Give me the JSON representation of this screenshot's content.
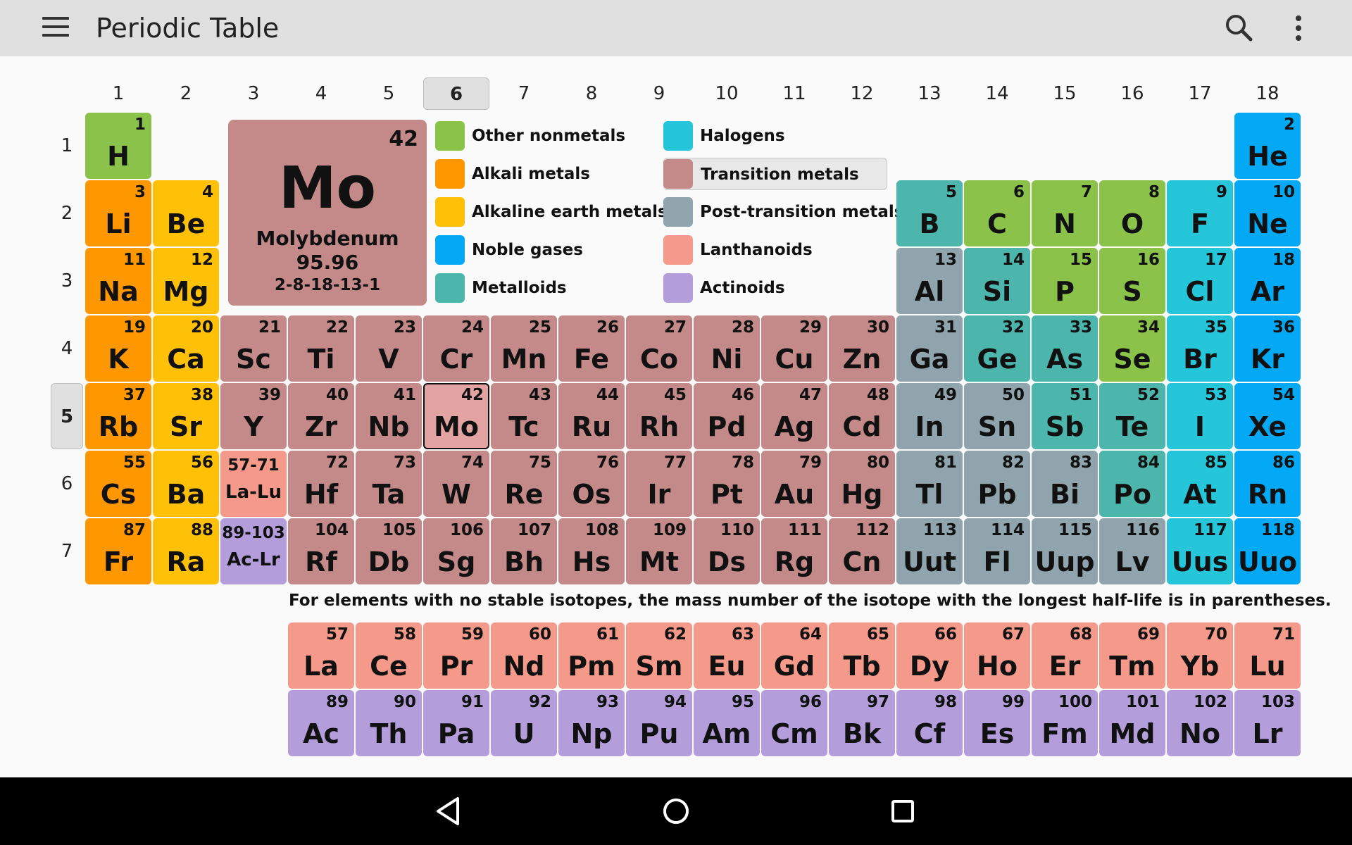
{
  "app": {
    "title": "Periodic Table"
  },
  "toolbar": {
    "menu_icon": "hamburger-menu-icon",
    "search_icon": "search-icon",
    "more_icon": "more-vertical-icon"
  },
  "groups": [
    "1",
    "2",
    "3",
    "4",
    "5",
    "6",
    "7",
    "8",
    "9",
    "10",
    "11",
    "12",
    "13",
    "14",
    "15",
    "16",
    "17",
    "18"
  ],
  "selected_group": "6",
  "periods": [
    "1",
    "2",
    "3",
    "4",
    "5",
    "6",
    "7"
  ],
  "selected_period": "5",
  "colors": {
    "nonmetal": "#8bc34a",
    "alkali": "#ff9800",
    "alkaline": "#ffc107",
    "noble": "#03a9f4",
    "metalloid": "#4db6ac",
    "halogen": "#26c6da",
    "transition": "#c48a8a",
    "post": "#90a4ae",
    "lanth": "#f59a8a",
    "actin": "#b39ddb",
    "selected_cell": "#e3a3a3"
  },
  "detail": {
    "number": "42",
    "symbol": "Mo",
    "name": "Molybdenum",
    "mass": "95.96",
    "config": "2-8-18-13-1"
  },
  "legend": [
    {
      "label": "Other nonmetals",
      "cat": "nonmetal"
    },
    {
      "label": "Alkali metals",
      "cat": "alkali"
    },
    {
      "label": "Alkaline earth metals",
      "cat": "alkaline"
    },
    {
      "label": "Noble gases",
      "cat": "noble"
    },
    {
      "label": "Metalloids",
      "cat": "metalloid"
    },
    {
      "label": "Halogens",
      "cat": "halogen"
    },
    {
      "label": "Transition metals",
      "cat": "transition",
      "selected": true
    },
    {
      "label": "Post-transition metals",
      "cat": "post"
    },
    {
      "label": "Lanthanoids",
      "cat": "lanth"
    },
    {
      "label": "Actinoids",
      "cat": "actin"
    }
  ],
  "main_table": [
    {
      "n": "1",
      "s": "H",
      "c": "nonmetal",
      "g": 1,
      "p": 1
    },
    {
      "n": "2",
      "s": "He",
      "c": "noble",
      "g": 18,
      "p": 1
    },
    {
      "n": "3",
      "s": "Li",
      "c": "alkali",
      "g": 1,
      "p": 2
    },
    {
      "n": "4",
      "s": "Be",
      "c": "alkaline",
      "g": 2,
      "p": 2
    },
    {
      "n": "5",
      "s": "B",
      "c": "metalloid",
      "g": 13,
      "p": 2
    },
    {
      "n": "6",
      "s": "C",
      "c": "nonmetal",
      "g": 14,
      "p": 2
    },
    {
      "n": "7",
      "s": "N",
      "c": "nonmetal",
      "g": 15,
      "p": 2
    },
    {
      "n": "8",
      "s": "O",
      "c": "nonmetal",
      "g": 16,
      "p": 2
    },
    {
      "n": "9",
      "s": "F",
      "c": "halogen",
      "g": 17,
      "p": 2
    },
    {
      "n": "10",
      "s": "Ne",
      "c": "noble",
      "g": 18,
      "p": 2
    },
    {
      "n": "11",
      "s": "Na",
      "c": "alkali",
      "g": 1,
      "p": 3
    },
    {
      "n": "12",
      "s": "Mg",
      "c": "alkaline",
      "g": 2,
      "p": 3
    },
    {
      "n": "13",
      "s": "Al",
      "c": "post",
      "g": 13,
      "p": 3
    },
    {
      "n": "14",
      "s": "Si",
      "c": "metalloid",
      "g": 14,
      "p": 3
    },
    {
      "n": "15",
      "s": "P",
      "c": "nonmetal",
      "g": 15,
      "p": 3
    },
    {
      "n": "16",
      "s": "S",
      "c": "nonmetal",
      "g": 16,
      "p": 3
    },
    {
      "n": "17",
      "s": "Cl",
      "c": "halogen",
      "g": 17,
      "p": 3
    },
    {
      "n": "18",
      "s": "Ar",
      "c": "noble",
      "g": 18,
      "p": 3
    },
    {
      "n": "19",
      "s": "K",
      "c": "alkali",
      "g": 1,
      "p": 4
    },
    {
      "n": "20",
      "s": "Ca",
      "c": "alkaline",
      "g": 2,
      "p": 4
    },
    {
      "n": "21",
      "s": "Sc",
      "c": "transition",
      "g": 3,
      "p": 4
    },
    {
      "n": "22",
      "s": "Ti",
      "c": "transition",
      "g": 4,
      "p": 4
    },
    {
      "n": "23",
      "s": "V",
      "c": "transition",
      "g": 5,
      "p": 4
    },
    {
      "n": "24",
      "s": "Cr",
      "c": "transition",
      "g": 6,
      "p": 4
    },
    {
      "n": "25",
      "s": "Mn",
      "c": "transition",
      "g": 7,
      "p": 4
    },
    {
      "n": "26",
      "s": "Fe",
      "c": "transition",
      "g": 8,
      "p": 4
    },
    {
      "n": "27",
      "s": "Co",
      "c": "transition",
      "g": 9,
      "p": 4
    },
    {
      "n": "28",
      "s": "Ni",
      "c": "transition",
      "g": 10,
      "p": 4
    },
    {
      "n": "29",
      "s": "Cu",
      "c": "transition",
      "g": 11,
      "p": 4
    },
    {
      "n": "30",
      "s": "Zn",
      "c": "transition",
      "g": 12,
      "p": 4
    },
    {
      "n": "31",
      "s": "Ga",
      "c": "post",
      "g": 13,
      "p": 4
    },
    {
      "n": "32",
      "s": "Ge",
      "c": "metalloid",
      "g": 14,
      "p": 4
    },
    {
      "n": "33",
      "s": "As",
      "c": "metalloid",
      "g": 15,
      "p": 4
    },
    {
      "n": "34",
      "s": "Se",
      "c": "nonmetal",
      "g": 16,
      "p": 4
    },
    {
      "n": "35",
      "s": "Br",
      "c": "halogen",
      "g": 17,
      "p": 4
    },
    {
      "n": "36",
      "s": "Kr",
      "c": "noble",
      "g": 18,
      "p": 4
    },
    {
      "n": "37",
      "s": "Rb",
      "c": "alkali",
      "g": 1,
      "p": 5
    },
    {
      "n": "38",
      "s": "Sr",
      "c": "alkaline",
      "g": 2,
      "p": 5
    },
    {
      "n": "39",
      "s": "Y",
      "c": "transition",
      "g": 3,
      "p": 5
    },
    {
      "n": "40",
      "s": "Zr",
      "c": "transition",
      "g": 4,
      "p": 5
    },
    {
      "n": "41",
      "s": "Nb",
      "c": "transition",
      "g": 5,
      "p": 5
    },
    {
      "n": "42",
      "s": "Mo",
      "c": "transition",
      "g": 6,
      "p": 5,
      "sel": true
    },
    {
      "n": "43",
      "s": "Tc",
      "c": "transition",
      "g": 7,
      "p": 5
    },
    {
      "n": "44",
      "s": "Ru",
      "c": "transition",
      "g": 8,
      "p": 5
    },
    {
      "n": "45",
      "s": "Rh",
      "c": "transition",
      "g": 9,
      "p": 5
    },
    {
      "n": "46",
      "s": "Pd",
      "c": "transition",
      "g": 10,
      "p": 5
    },
    {
      "n": "47",
      "s": "Ag",
      "c": "transition",
      "g": 11,
      "p": 5
    },
    {
      "n": "48",
      "s": "Cd",
      "c": "transition",
      "g": 12,
      "p": 5
    },
    {
      "n": "49",
      "s": "In",
      "c": "post",
      "g": 13,
      "p": 5
    },
    {
      "n": "50",
      "s": "Sn",
      "c": "post",
      "g": 14,
      "p": 5
    },
    {
      "n": "51",
      "s": "Sb",
      "c": "metalloid",
      "g": 15,
      "p": 5
    },
    {
      "n": "52",
      "s": "Te",
      "c": "metalloid",
      "g": 16,
      "p": 5
    },
    {
      "n": "53",
      "s": "I",
      "c": "halogen",
      "g": 17,
      "p": 5
    },
    {
      "n": "54",
      "s": "Xe",
      "c": "noble",
      "g": 18,
      "p": 5
    },
    {
      "n": "55",
      "s": "Cs",
      "c": "alkali",
      "g": 1,
      "p": 6
    },
    {
      "n": "56",
      "s": "Ba",
      "c": "alkaline",
      "g": 2,
      "p": 6
    },
    {
      "n": "57-71",
      "s": "La-Lu",
      "c": "lanth",
      "g": 3,
      "p": 6,
      "range": true
    },
    {
      "n": "72",
      "s": "Hf",
      "c": "transition",
      "g": 4,
      "p": 6
    },
    {
      "n": "73",
      "s": "Ta",
      "c": "transition",
      "g": 5,
      "p": 6
    },
    {
      "n": "74",
      "s": "W",
      "c": "transition",
      "g": 6,
      "p": 6
    },
    {
      "n": "75",
      "s": "Re",
      "c": "transition",
      "g": 7,
      "p": 6
    },
    {
      "n": "76",
      "s": "Os",
      "c": "transition",
      "g": 8,
      "p": 6
    },
    {
      "n": "77",
      "s": "Ir",
      "c": "transition",
      "g": 9,
      "p": 6
    },
    {
      "n": "78",
      "s": "Pt",
      "c": "transition",
      "g": 10,
      "p": 6
    },
    {
      "n": "79",
      "s": "Au",
      "c": "transition",
      "g": 11,
      "p": 6
    },
    {
      "n": "80",
      "s": "Hg",
      "c": "transition",
      "g": 12,
      "p": 6
    },
    {
      "n": "81",
      "s": "Tl",
      "c": "post",
      "g": 13,
      "p": 6
    },
    {
      "n": "82",
      "s": "Pb",
      "c": "post",
      "g": 14,
      "p": 6
    },
    {
      "n": "83",
      "s": "Bi",
      "c": "post",
      "g": 15,
      "p": 6
    },
    {
      "n": "84",
      "s": "Po",
      "c": "metalloid",
      "g": 16,
      "p": 6
    },
    {
      "n": "85",
      "s": "At",
      "c": "halogen",
      "g": 17,
      "p": 6
    },
    {
      "n": "86",
      "s": "Rn",
      "c": "noble",
      "g": 18,
      "p": 6
    },
    {
      "n": "87",
      "s": "Fr",
      "c": "alkali",
      "g": 1,
      "p": 7
    },
    {
      "n": "88",
      "s": "Ra",
      "c": "alkaline",
      "g": 2,
      "p": 7
    },
    {
      "n": "89-103",
      "s": "Ac-Lr",
      "c": "actin",
      "g": 3,
      "p": 7,
      "range": true
    },
    {
      "n": "104",
      "s": "Rf",
      "c": "transition",
      "g": 4,
      "p": 7
    },
    {
      "n": "105",
      "s": "Db",
      "c": "transition",
      "g": 5,
      "p": 7
    },
    {
      "n": "106",
      "s": "Sg",
      "c": "transition",
      "g": 6,
      "p": 7
    },
    {
      "n": "107",
      "s": "Bh",
      "c": "transition",
      "g": 7,
      "p": 7
    },
    {
      "n": "108",
      "s": "Hs",
      "c": "transition",
      "g": 8,
      "p": 7
    },
    {
      "n": "109",
      "s": "Mt",
      "c": "transition",
      "g": 9,
      "p": 7
    },
    {
      "n": "110",
      "s": "Ds",
      "c": "transition",
      "g": 10,
      "p": 7
    },
    {
      "n": "111",
      "s": "Rg",
      "c": "transition",
      "g": 11,
      "p": 7
    },
    {
      "n": "112",
      "s": "Cn",
      "c": "transition",
      "g": 12,
      "p": 7
    },
    {
      "n": "113",
      "s": "Uut",
      "c": "post",
      "g": 13,
      "p": 7
    },
    {
      "n": "114",
      "s": "Fl",
      "c": "post",
      "g": 14,
      "p": 7
    },
    {
      "n": "115",
      "s": "Uup",
      "c": "post",
      "g": 15,
      "p": 7
    },
    {
      "n": "116",
      "s": "Lv",
      "c": "post",
      "g": 16,
      "p": 7
    },
    {
      "n": "117",
      "s": "Uus",
      "c": "halogen",
      "g": 17,
      "p": 7
    },
    {
      "n": "118",
      "s": "Uuo",
      "c": "noble",
      "g": 18,
      "p": 7
    }
  ],
  "lanthanoids": [
    {
      "n": "57",
      "s": "La"
    },
    {
      "n": "58",
      "s": "Ce"
    },
    {
      "n": "59",
      "s": "Pr"
    },
    {
      "n": "60",
      "s": "Nd"
    },
    {
      "n": "61",
      "s": "Pm"
    },
    {
      "n": "62",
      "s": "Sm"
    },
    {
      "n": "63",
      "s": "Eu"
    },
    {
      "n": "64",
      "s": "Gd"
    },
    {
      "n": "65",
      "s": "Tb"
    },
    {
      "n": "66",
      "s": "Dy"
    },
    {
      "n": "67",
      "s": "Ho"
    },
    {
      "n": "68",
      "s": "Er"
    },
    {
      "n": "69",
      "s": "Tm"
    },
    {
      "n": "70",
      "s": "Yb"
    },
    {
      "n": "71",
      "s": "Lu"
    }
  ],
  "actinoids": [
    {
      "n": "89",
      "s": "Ac"
    },
    {
      "n": "90",
      "s": "Th"
    },
    {
      "n": "91",
      "s": "Pa"
    },
    {
      "n": "92",
      "s": "U"
    },
    {
      "n": "93",
      "s": "Np"
    },
    {
      "n": "94",
      "s": "Pu"
    },
    {
      "n": "95",
      "s": "Am"
    },
    {
      "n": "96",
      "s": "Cm"
    },
    {
      "n": "97",
      "s": "Bk"
    },
    {
      "n": "98",
      "s": "Cf"
    },
    {
      "n": "99",
      "s": "Es"
    },
    {
      "n": "100",
      "s": "Fm"
    },
    {
      "n": "101",
      "s": "Md"
    },
    {
      "n": "102",
      "s": "No"
    },
    {
      "n": "103",
      "s": "Lr"
    }
  ],
  "note": "For elements with no stable isotopes, the mass number of the isotope with the longest half-life is in parentheses.",
  "navbar": {
    "back_icon": "back-triangle-icon",
    "home_icon": "home-circle-icon",
    "recents_icon": "recents-square-icon"
  }
}
